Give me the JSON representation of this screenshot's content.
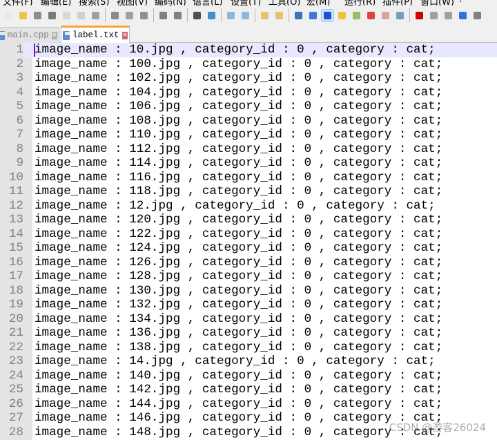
{
  "menu": [
    "文件(F)",
    "编辑(E)",
    "搜索(S)",
    "视图(V)",
    "编码(N)",
    "语言(L)",
    "设置(T)",
    "工具(O)",
    "宏(M)",
    "运行(R)",
    "插件(P)",
    "窗口(W)",
    "?"
  ],
  "toolbar": [
    {
      "icon": "new-file-icon",
      "color": "#e8e8e8"
    },
    {
      "icon": "open-file-icon",
      "color": "#f2c24f"
    },
    {
      "icon": "save-icon",
      "color": "#8c8c8c"
    },
    {
      "icon": "save-all-icon",
      "color": "#7a7a7a"
    },
    {
      "icon": "close-icon",
      "color": "#d8d8d8"
    },
    {
      "icon": "close-all-icon",
      "color": "#d0d0d0"
    },
    {
      "icon": "print-icon",
      "color": "#9aa0a8"
    },
    "sep",
    {
      "icon": "cut-icon",
      "color": "#8a8a8a"
    },
    {
      "icon": "copy-icon",
      "color": "#a0a0a0"
    },
    {
      "icon": "paste-icon",
      "color": "#909090"
    },
    "sep",
    {
      "icon": "undo-icon",
      "color": "#808080"
    },
    {
      "icon": "redo-icon",
      "color": "#808080"
    },
    "sep",
    {
      "icon": "find-icon",
      "color": "#505050"
    },
    {
      "icon": "replace-icon",
      "color": "#3c8fd0"
    },
    "sep",
    {
      "icon": "zoom-in-icon",
      "color": "#8cb8e0"
    },
    {
      "icon": "zoom-out-icon",
      "color": "#8cb8e0"
    },
    "sep",
    {
      "icon": "sync-vertical-icon",
      "color": "#e8c070"
    },
    {
      "icon": "sync-horizontal-icon",
      "color": "#e8c070"
    },
    "sep",
    {
      "icon": "word-wrap-icon",
      "color": "#4070c0"
    },
    {
      "icon": "show-all-chars-icon",
      "color": "#3c78d8"
    },
    {
      "icon": "indent-guide-icon",
      "color": "#2050d0",
      "active": true
    },
    {
      "icon": "doc-map-icon",
      "color": "#f0c040"
    },
    {
      "icon": "function-list-icon",
      "color": "#90c060"
    },
    {
      "icon": "folder-workspace-icon",
      "color": "#e04040"
    },
    {
      "icon": "document-list-icon",
      "color": "#e0a0a0"
    },
    {
      "icon": "monitoring-icon",
      "color": "#70a0c0"
    },
    "sep",
    {
      "icon": "record-macro-icon",
      "color": "#d00000"
    },
    {
      "icon": "stop-macro-icon",
      "color": "#a0a0a0"
    },
    {
      "icon": "play-macro-icon",
      "color": "#a0a0a0"
    },
    {
      "icon": "run-macro-multiple-icon",
      "color": "#3070e0"
    },
    {
      "icon": "save-macro-icon",
      "color": "#808080"
    }
  ],
  "tabs": [
    {
      "label": "main.cpp",
      "active": false
    },
    {
      "label": "label.txt",
      "active": true
    }
  ],
  "lines": [
    "image_name : 10.jpg , category_id : 0 , category : cat;",
    "image_name : 100.jpg , category_id : 0 , category : cat;",
    "image_name : 102.jpg , category_id : 0 , category : cat;",
    "image_name : 104.jpg , category_id : 0 , category : cat;",
    "image_name : 106.jpg , category_id : 0 , category : cat;",
    "image_name : 108.jpg , category_id : 0 , category : cat;",
    "image_name : 110.jpg , category_id : 0 , category : cat;",
    "image_name : 112.jpg , category_id : 0 , category : cat;",
    "image_name : 114.jpg , category_id : 0 , category : cat;",
    "image_name : 116.jpg , category_id : 0 , category : cat;",
    "image_name : 118.jpg , category_id : 0 , category : cat;",
    "image_name : 12.jpg , category_id : 0 , category : cat;",
    "image_name : 120.jpg , category_id : 0 , category : cat;",
    "image_name : 122.jpg , category_id : 0 , category : cat;",
    "image_name : 124.jpg , category_id : 0 , category : cat;",
    "image_name : 126.jpg , category_id : 0 , category : cat;",
    "image_name : 128.jpg , category_id : 0 , category : cat;",
    "image_name : 130.jpg , category_id : 0 , category : cat;",
    "image_name : 132.jpg , category_id : 0 , category : cat;",
    "image_name : 134.jpg , category_id : 0 , category : cat;",
    "image_name : 136.jpg , category_id : 0 , category : cat;",
    "image_name : 138.jpg , category_id : 0 , category : cat;",
    "image_name : 14.jpg , category_id : 0 , category : cat;",
    "image_name : 140.jpg , category_id : 0 , category : cat;",
    "image_name : 142.jpg , category_id : 0 , category : cat;",
    "image_name : 144.jpg , category_id : 0 , category : cat;",
    "image_name : 146.jpg , category_id : 0 , category : cat;",
    "image_name : 148.jpg , category_id : 0 , category : cat;"
  ],
  "current_line": 1,
  "watermark": "CSDN @游客26024"
}
